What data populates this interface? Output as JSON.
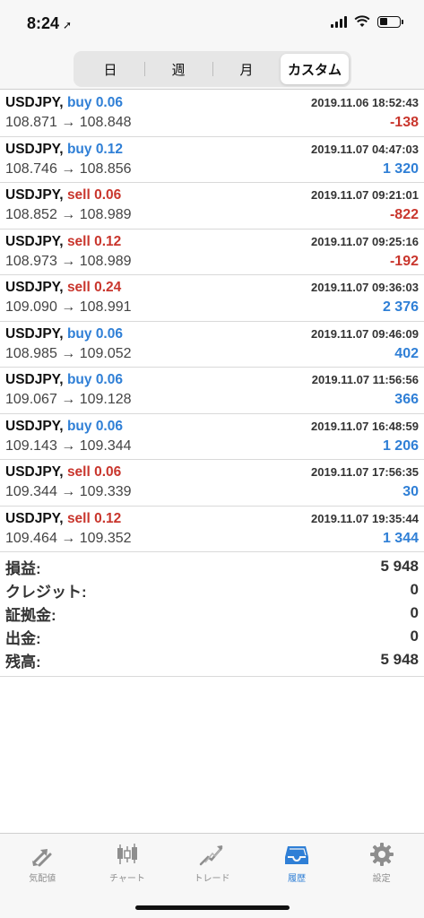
{
  "status_bar": {
    "time": "8:24",
    "location_glyph": "➚"
  },
  "period_tabs": [
    {
      "label": "日",
      "active": false
    },
    {
      "label": "週",
      "active": false
    },
    {
      "label": "月",
      "active": false
    },
    {
      "label": "カスタム",
      "active": true
    }
  ],
  "trades": [
    {
      "symbol": "USDJPY,",
      "side": "buy",
      "volume": "0.06",
      "datetime": "2019.11.06 18:52:43",
      "prices": "108.871 → 108.848",
      "profit": "-138"
    },
    {
      "symbol": "USDJPY,",
      "side": "buy",
      "volume": "0.12",
      "datetime": "2019.11.07 04:47:03",
      "prices": "108.746 → 108.856",
      "profit": "1 320"
    },
    {
      "symbol": "USDJPY,",
      "side": "sell",
      "volume": "0.06",
      "datetime": "2019.11.07 09:21:01",
      "prices": "108.852 → 108.989",
      "profit": "-822"
    },
    {
      "symbol": "USDJPY,",
      "side": "sell",
      "volume": "0.12",
      "datetime": "2019.11.07 09:25:16",
      "prices": "108.973 → 108.989",
      "profit": "-192"
    },
    {
      "symbol": "USDJPY,",
      "side": "sell",
      "volume": "0.24",
      "datetime": "2019.11.07 09:36:03",
      "prices": "109.090 → 108.991",
      "profit": "2 376"
    },
    {
      "symbol": "USDJPY,",
      "side": "buy",
      "volume": "0.06",
      "datetime": "2019.11.07 09:46:09",
      "prices": "108.985 → 109.052",
      "profit": "402"
    },
    {
      "symbol": "USDJPY,",
      "side": "buy",
      "volume": "0.06",
      "datetime": "2019.11.07 11:56:56",
      "prices": "109.067 → 109.128",
      "profit": "366"
    },
    {
      "symbol": "USDJPY,",
      "side": "buy",
      "volume": "0.06",
      "datetime": "2019.11.07 16:48:59",
      "prices": "109.143 → 109.344",
      "profit": "1 206"
    },
    {
      "symbol": "USDJPY,",
      "side": "sell",
      "volume": "0.06",
      "datetime": "2019.11.07 17:56:35",
      "prices": "109.344 → 109.339",
      "profit": "30"
    },
    {
      "symbol": "USDJPY,",
      "side": "sell",
      "volume": "0.12",
      "datetime": "2019.11.07 19:35:44",
      "prices": "109.464 → 109.352",
      "profit": "1 344"
    }
  ],
  "summary": [
    {
      "label": "損益:",
      "value": "5 948"
    },
    {
      "label": "クレジット:",
      "value": "0"
    },
    {
      "label": "証拠金:",
      "value": "0"
    },
    {
      "label": "出金:",
      "value": "0"
    },
    {
      "label": "残高:",
      "value": "5 948"
    }
  ],
  "tabbar": [
    {
      "label": "気配値",
      "icon": "arrows-updown-icon",
      "active": false
    },
    {
      "label": "チャート",
      "icon": "candlestick-icon",
      "active": false
    },
    {
      "label": "トレード",
      "icon": "trend-line-icon",
      "active": false
    },
    {
      "label": "履歴",
      "icon": "inbox-tray-icon",
      "active": true
    },
    {
      "label": "設定",
      "icon": "gear-icon",
      "active": false
    }
  ],
  "colors": {
    "buy": "#2f7fd6",
    "sell": "#c9362d",
    "profit_positive": "#2f7fd6",
    "profit_negative": "#c9362d",
    "active_tab": "#2f7fd6",
    "inactive_tab": "#8e8e8e"
  }
}
